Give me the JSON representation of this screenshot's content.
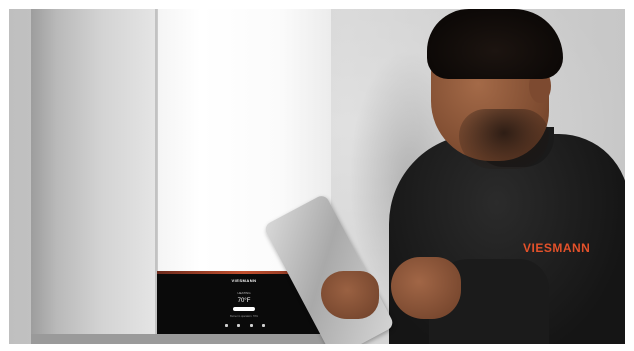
{
  "image": {
    "description_free": true
  },
  "boiler": {
    "panel_brand": "VIESMANN",
    "panel_mode": "HEATING",
    "panel_temperature": "70°F",
    "panel_status": "Burner in operation: 70%"
  },
  "shirt": {
    "logo": "VIESMANN"
  },
  "colors": {
    "brand_orange": "#e3512a",
    "panel_black": "#0a0a0a",
    "shirt_black": "#151515"
  }
}
